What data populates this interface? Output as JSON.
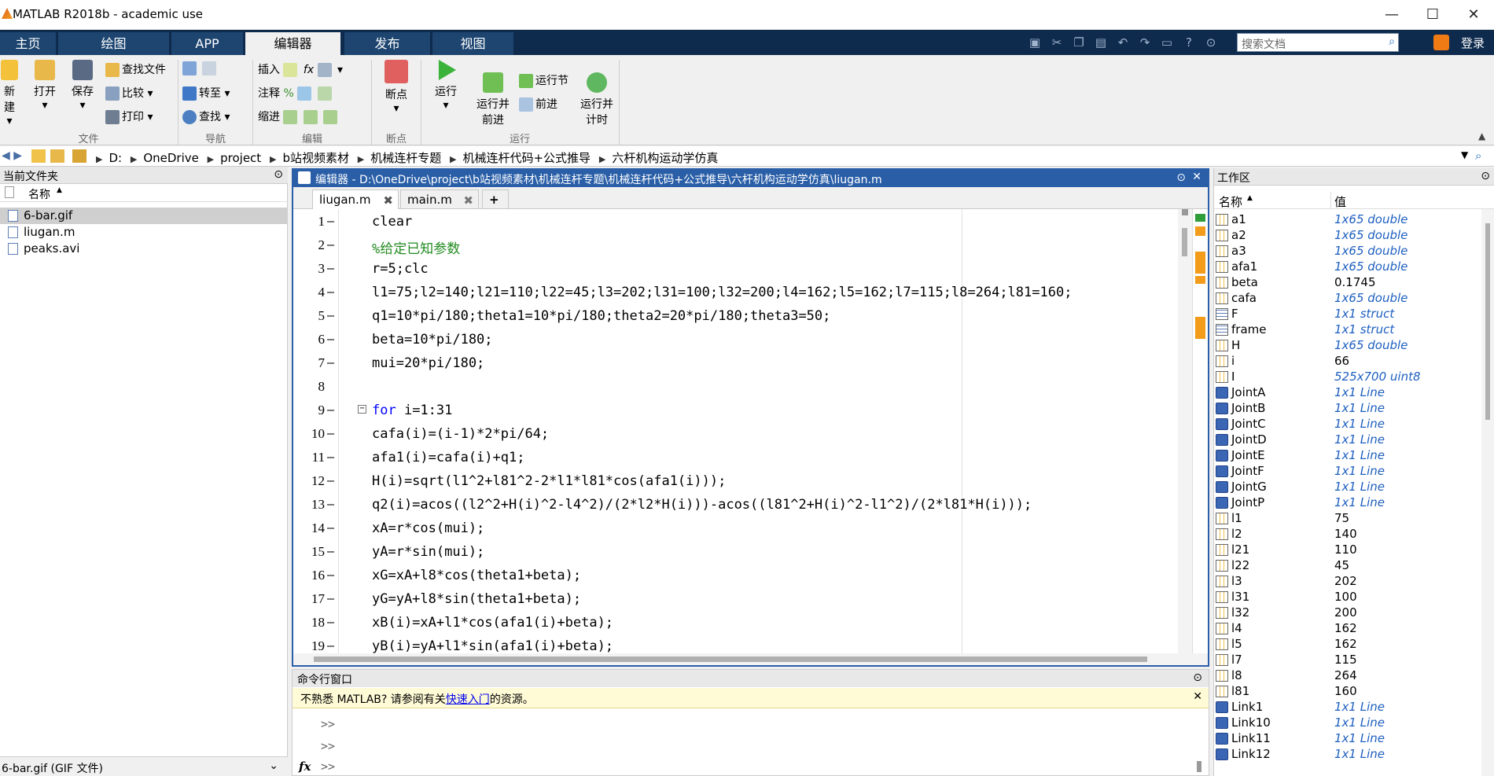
{
  "window": {
    "title": "MATLAB R2018b - academic use",
    "min": "—",
    "max": "☐",
    "close": "✕"
  },
  "ribbon_tabs": [
    "主页",
    "绘图",
    "APP",
    "编辑器",
    "发布",
    "视图"
  ],
  "search": {
    "placeholder": "搜索文档"
  },
  "login_label": "登录",
  "ribbon": {
    "file": {
      "new": "新建",
      "open": "打开",
      "save": "保存",
      "find_files": "查找文件",
      "compare": "比较",
      "print": "打印",
      "label": "文件"
    },
    "nav": {
      "goto": "转至",
      "find": "查找",
      "label": "导航"
    },
    "edit": {
      "insert": "插入",
      "comment": "注释",
      "indent": "缩进",
      "label": "编辑"
    },
    "breakpoints": {
      "btn": "断点",
      "label": "断点"
    },
    "run": {
      "run": "运行",
      "run_advance": "运行并\n前进",
      "run_section": "运行节",
      "advance": "前进",
      "run_time": "运行并\n计时",
      "label": "运行"
    }
  },
  "path": [
    "D:",
    "OneDrive",
    "project",
    "b站视频素材",
    "机械连杆专题",
    "机械连杆代码+公式推导",
    "六杆机构运动学仿真"
  ],
  "current_folder": {
    "title": "当前文件夹",
    "col_name": "名称",
    "files": [
      "6-bar.gif",
      "liugan.m",
      "peaks.avi"
    ],
    "detail": "6-bar.gif  (GIF 文件)"
  },
  "editor": {
    "title": "编辑器 - D:\\OneDrive\\project\\b站视频素材\\机械连杆专题\\机械连杆代码+公式推导\\六杆机构运动学仿真\\liugan.m",
    "tabs": [
      "liugan.m",
      "main.m"
    ],
    "lines": [
      {
        "n": "1",
        "t": "clear",
        "type": "plain"
      },
      {
        "n": "2",
        "t": "%给定已知参数",
        "type": "comment"
      },
      {
        "n": "3",
        "t": "r=5;clc",
        "type": "plain"
      },
      {
        "n": "4",
        "t": "l1=75;l2=140;l21=110;l22=45;l3=202;l31=100;l32=200;l4=162;l5=162;l7=115;l8=264;l81=160;",
        "type": "plain"
      },
      {
        "n": "5",
        "t": "q1=10*pi/180;theta1=10*pi/180;theta2=20*pi/180;theta3=50;",
        "type": "plain"
      },
      {
        "n": "6",
        "t": "beta=10*pi/180;",
        "type": "plain"
      },
      {
        "n": "7",
        "t": "mui=20*pi/180;",
        "type": "plain"
      },
      {
        "n": "8",
        "t": "",
        "type": "plain"
      },
      {
        "n": "9",
        "t": "i=1:31",
        "kw": "for",
        "type": "for"
      },
      {
        "n": "10",
        "t": "cafa(i)=(i-1)*2*pi/64;",
        "type": "plain"
      },
      {
        "n": "11",
        "t": "afa1(i)=cafa(i)+q1;",
        "type": "plain"
      },
      {
        "n": "12",
        "t": "H(i)=sqrt(l1^2+l81^2-2*l1*l81*cos(afa1(i)));",
        "type": "plain"
      },
      {
        "n": "13",
        "t": "q2(i)=acos((l2^2+H(i)^2-l4^2)/(2*l2*H(i)))-acos((l81^2+H(i)^2-l1^2)/(2*l81*H(i)));",
        "type": "plain"
      },
      {
        "n": "14",
        "t": "xA=r*cos(mui);",
        "type": "plain"
      },
      {
        "n": "15",
        "t": "yA=r*sin(mui);",
        "type": "plain"
      },
      {
        "n": "16",
        "t": "xG=xA+l8*cos(theta1+beta);",
        "type": "plain"
      },
      {
        "n": "17",
        "t": "yG=yA+l8*sin(theta1+beta);",
        "type": "plain"
      },
      {
        "n": "18",
        "t": "xB(i)=xA+l1*cos(afa1(i)+beta);",
        "type": "plain"
      },
      {
        "n": "19",
        "t": "yB(i)=yA+l1*sin(afa1(i)+beta);",
        "type": "plain"
      }
    ]
  },
  "command_window": {
    "title": "命令行窗口",
    "banner_pre": "不熟悉 MATLAB? 请参阅有关",
    "banner_link": "快速入门",
    "banner_post": "的资源。",
    "prompt": ">>",
    "fx": "fx"
  },
  "workspace": {
    "title": "工作区",
    "col_name": "名称",
    "col_value": "值",
    "vars": [
      {
        "name": "a1",
        "value": "1x65 double",
        "icon": "grid",
        "italic": true
      },
      {
        "name": "a2",
        "value": "1x65 double",
        "icon": "grid",
        "italic": true
      },
      {
        "name": "a3",
        "value": "1x65 double",
        "icon": "grid",
        "italic": true
      },
      {
        "name": "afa1",
        "value": "1x65 double",
        "icon": "grid",
        "italic": true
      },
      {
        "name": "beta",
        "value": "0.1745",
        "icon": "grid",
        "italic": false
      },
      {
        "name": "cafa",
        "value": "1x65 double",
        "icon": "grid",
        "italic": true
      },
      {
        "name": "F",
        "value": "1x1 struct",
        "icon": "struct",
        "italic": true
      },
      {
        "name": "frame",
        "value": "1x1 struct",
        "icon": "struct",
        "italic": true
      },
      {
        "name": "H",
        "value": "1x65 double",
        "icon": "grid",
        "italic": true
      },
      {
        "name": "i",
        "value": "66",
        "icon": "grid",
        "italic": false
      },
      {
        "name": "I",
        "value": "525x700 uint8",
        "icon": "grid",
        "italic": true
      },
      {
        "name": "JointA",
        "value": "1x1 Line",
        "icon": "obj",
        "italic": true
      },
      {
        "name": "JointB",
        "value": "1x1 Line",
        "icon": "obj",
        "italic": true
      },
      {
        "name": "JointC",
        "value": "1x1 Line",
        "icon": "obj",
        "italic": true
      },
      {
        "name": "JointD",
        "value": "1x1 Line",
        "icon": "obj",
        "italic": true
      },
      {
        "name": "JointE",
        "value": "1x1 Line",
        "icon": "obj",
        "italic": true
      },
      {
        "name": "JointF",
        "value": "1x1 Line",
        "icon": "obj",
        "italic": true
      },
      {
        "name": "JointG",
        "value": "1x1 Line",
        "icon": "obj",
        "italic": true
      },
      {
        "name": "JointP",
        "value": "1x1 Line",
        "icon": "obj",
        "italic": true
      },
      {
        "name": "l1",
        "value": "75",
        "icon": "grid",
        "italic": false
      },
      {
        "name": "l2",
        "value": "140",
        "icon": "grid",
        "italic": false
      },
      {
        "name": "l21",
        "value": "110",
        "icon": "grid",
        "italic": false
      },
      {
        "name": "l22",
        "value": "45",
        "icon": "grid",
        "italic": false
      },
      {
        "name": "l3",
        "value": "202",
        "icon": "grid",
        "italic": false
      },
      {
        "name": "l31",
        "value": "100",
        "icon": "grid",
        "italic": false
      },
      {
        "name": "l32",
        "value": "200",
        "icon": "grid",
        "italic": false
      },
      {
        "name": "l4",
        "value": "162",
        "icon": "grid",
        "italic": false
      },
      {
        "name": "l5",
        "value": "162",
        "icon": "grid",
        "italic": false
      },
      {
        "name": "l7",
        "value": "115",
        "icon": "grid",
        "italic": false
      },
      {
        "name": "l8",
        "value": "264",
        "icon": "grid",
        "italic": false
      },
      {
        "name": "l81",
        "value": "160",
        "icon": "grid",
        "italic": false
      },
      {
        "name": "Link1",
        "value": "1x1 Line",
        "icon": "obj",
        "italic": true
      },
      {
        "name": "Link10",
        "value": "1x1 Line",
        "icon": "obj",
        "italic": true
      },
      {
        "name": "Link11",
        "value": "1x1 Line",
        "icon": "obj",
        "italic": true
      },
      {
        "name": "Link12",
        "value": "1x1 Line",
        "icon": "obj",
        "italic": true
      }
    ]
  },
  "colors": {
    "tabbar": "#0e2a4d",
    "editor_border": "#2a5fa8",
    "keyword": "#0000ff",
    "comment": "#228b22",
    "ws_value_blue": "#1e5fc0",
    "marker_orange": "#f39b1a"
  }
}
